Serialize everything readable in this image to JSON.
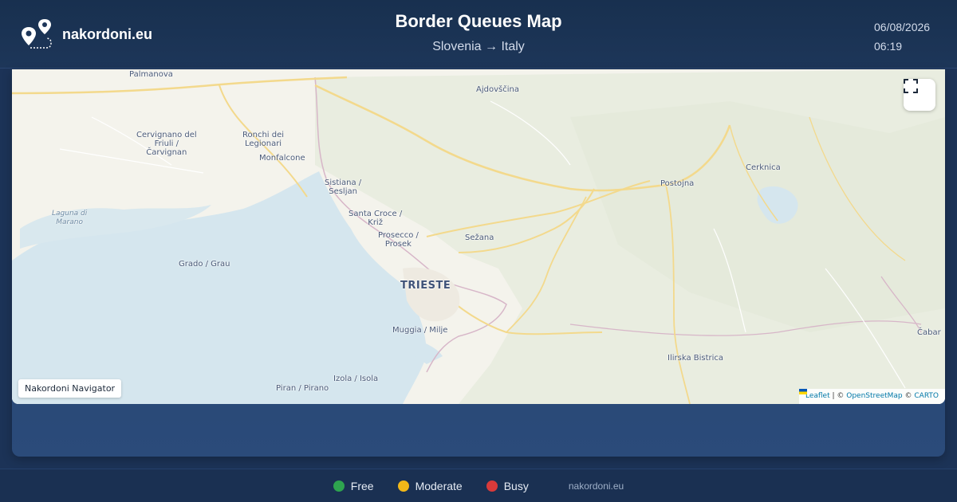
{
  "header": {
    "site_name": "nakordoni.eu",
    "title": "Border Queues Map",
    "route": "Slovenia → Italy",
    "date": "06/08/2026",
    "time": "06:19",
    "logo_icon": "map-pins-route-icon"
  },
  "map": {
    "places": {
      "palmanova": "Palmanova",
      "ajdovscina": "Ajdovščina",
      "cervignano_1": "Cervignano del",
      "cervignano_2": "Friuli /",
      "cervignano_3": "Čarvignan",
      "ronchi_1": "Ronchi dei",
      "ronchi_2": "Legionari",
      "monfalcone": "Monfalcone",
      "sistiana_1": "Sistiana /",
      "sistiana_2": "Sesljan",
      "santacroce_1": "Santa Croce /",
      "santacroce_2": "Križ",
      "prosecco_1": "Prosecco /",
      "prosecco_2": "Prosek",
      "sezana": "Sežana",
      "postojna": "Postojna",
      "cerknica": "Cerknica",
      "laguna_1": "Laguna di",
      "laguna_2": "Marano",
      "grado": "Grado / Grau",
      "trieste": "TRIESTE",
      "muggia": "Muggia / Milje",
      "ilirska": "Ilirska Bistrica",
      "cabar": "Čabar",
      "izola": "Izola / Isola",
      "piran": "Piran / Pirano"
    },
    "fullscreen_icon": "fullscreen-icon",
    "nav_badge": "Nakordoni Navigator",
    "attribution": {
      "leaflet": "Leaflet",
      "sep1": " | © ",
      "osm": "OpenStreetMap",
      "sep2": " © ",
      "carto": "CARTO"
    }
  },
  "legend": {
    "items": [
      {
        "label": "Free",
        "color": "#2ea44f"
      },
      {
        "label": "Moderate",
        "color": "#f2b818"
      },
      {
        "label": "Busy",
        "color": "#d93a3a"
      }
    ],
    "site": "nakordoni.eu"
  }
}
